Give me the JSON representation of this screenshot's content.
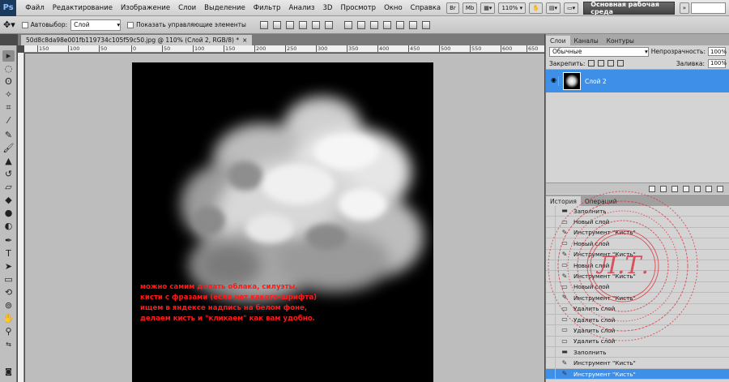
{
  "app": {
    "logo": "Ps",
    "menu": [
      "Файл",
      "Редактирование",
      "Изображение",
      "Слои",
      "Выделение",
      "Фильтр",
      "Анализ",
      "3D",
      "Просмотр",
      "Окно",
      "Справка"
    ],
    "mb_buttons": [
      "Br",
      "Mb"
    ],
    "zoom": "110%",
    "workspace": "Основная рабочая среда"
  },
  "options": {
    "autoselect_label": "Автовыбор:",
    "autoselect_value": "Слой",
    "show_controls_label": "Показать управляющие элементы"
  },
  "document": {
    "tab_title": "50d8c8da98e001fb119734c105f59c50.jpg @ 110% (Слой 2, RGB/8) *",
    "close": "×"
  },
  "ruler_ticks": [
    "150",
    "100",
    "50",
    "0",
    "50",
    "100",
    "150",
    "200",
    "250",
    "300",
    "350",
    "400",
    "450",
    "500",
    "550",
    "600",
    "650"
  ],
  "canvas": {
    "caption": "можно самим делать облака, силуэты,\nкисти с фразами (если нет какого-шрифта)\nищем в яндексе надпись на белом фоне,\nделаем кисть и \"кликаем\" как вам удобно."
  },
  "layers_panel": {
    "tabs": [
      "Слои",
      "Каналы",
      "Контуры"
    ],
    "blend_mode": "Обычные",
    "opacity_label": "Непрозрачность:",
    "opacity_value": "100%",
    "lock_label": "Закрепить:",
    "fill_label": "Заливка:",
    "fill_value": "100%",
    "layer_name": "Слой 2"
  },
  "history_panel": {
    "tabs": [
      "История",
      "Операций"
    ],
    "items": [
      {
        "label": "Заполнить",
        "icon": "fill-icon"
      },
      {
        "label": "Новый слой",
        "icon": "layer-icon"
      },
      {
        "label": "Инструмент \"Кисть\"",
        "icon": "brush-icon"
      },
      {
        "label": "Новый слой",
        "icon": "layer-icon"
      },
      {
        "label": "Инструмент \"Кисть\"",
        "icon": "brush-icon"
      },
      {
        "label": "Новый слой",
        "icon": "layer-icon"
      },
      {
        "label": "Инструмент \"Кисть\"",
        "icon": "brush-icon"
      },
      {
        "label": "Новый слой",
        "icon": "layer-icon"
      },
      {
        "label": "Инструмент \"Кисть\"",
        "icon": "brush-icon"
      },
      {
        "label": "Удалить слой",
        "icon": "layer-icon"
      },
      {
        "label": "Удалить слой",
        "icon": "layer-icon"
      },
      {
        "label": "Удалить слой",
        "icon": "layer-icon"
      },
      {
        "label": "Удалить слой",
        "icon": "layer-icon"
      },
      {
        "label": "Заполнить",
        "icon": "fill-icon"
      },
      {
        "label": "Инструмент \"Кисть\"",
        "icon": "brush-icon"
      },
      {
        "label": "Инструмент \"Кисть\"",
        "icon": "brush-icon",
        "selected": true
      }
    ]
  },
  "watermark": {
    "initials": "Л.Т."
  },
  "colors": {
    "accent": "#3d8fe8",
    "caption": "#ff1a1a",
    "foreground_swatch": "#ffffff",
    "background_swatch": "#ffee00",
    "stamp": "#d8323c"
  }
}
